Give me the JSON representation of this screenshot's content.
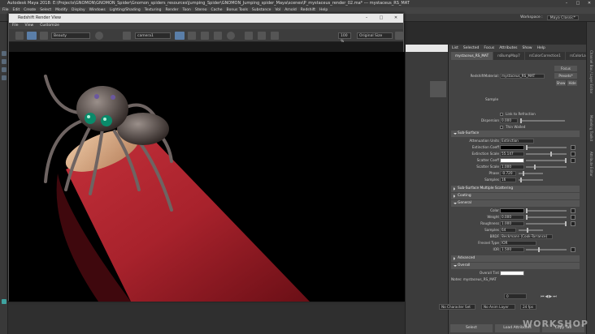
{
  "app": {
    "title": "Autodesk Maya 2018: E:\\Projects\\GNOMON\\GNOMON_Spider\\Gnomon_spiders_resources\\Jumping_Spider\\GNOMON_Jumping_spider_Maya\\scenes\\P_mystaceus_render_02.ma* --- mystaceus_RS_MAT",
    "workspace_label": "Workspace :",
    "workspace_value": "Maya Classic*"
  },
  "menubar": [
    "File",
    "Edit",
    "Create",
    "Select",
    "Modify",
    "Display",
    "Windows",
    "Lighting/Shading",
    "Texturing",
    "Render",
    "Toon",
    "Stereo",
    "Cache",
    "Bonus Tools",
    "Substance",
    "Vol",
    "Arnold",
    "Redshift",
    "Help"
  ],
  "render_view": {
    "title": "Redshift Render View",
    "menu": [
      "File",
      "View",
      "Customize"
    ],
    "aov_combo": "Beauty",
    "camera_combo": "camera1",
    "zoom": "100 %",
    "size_combo": "Original Size"
  },
  "attr_editor": {
    "menu": [
      "List",
      "Selected",
      "Focus",
      "Attributes",
      "Show",
      "Help"
    ],
    "tabs": [
      "mystaceus_RS_MAT",
      "rsBumpMap7",
      "rsColorCorrection1",
      "rsColorLayer"
    ],
    "material_label": "RedshiftMaterial:",
    "material_value": "mystaceus_RS_MAT",
    "focus_btn": "Focus",
    "presets_btn": "Presets*",
    "show_btn": "Show",
    "hide_btn": "Hide",
    "sample_label": "Sample",
    "link_refraction": "Link to Refraction",
    "dispersion_label": "Dispersion",
    "dispersion_value": "0.000",
    "thin_walled": "Thin Walled",
    "sections": {
      "sub_surface": "Sub-Surface",
      "sss_multiple": "Sub-Surface Multiple Scattering",
      "coating": "Coating",
      "general": "General",
      "advanced": "Advanced",
      "overall": "Overall"
    },
    "ss_rows": [
      {
        "label": "Attenuation Units",
        "value": "Extinction"
      },
      {
        "label": "Extinction Coeff",
        "value": ""
      },
      {
        "label": "Extinction Scale",
        "value": "55.147"
      },
      {
        "label": "Scatter Coeff",
        "value": ""
      },
      {
        "label": "Scatter Scale",
        "value": "1.000"
      },
      {
        "label": "Phase",
        "value": "-0.720"
      },
      {
        "label": "Samples",
        "value": "16"
      }
    ],
    "general_rows": [
      {
        "label": "Color",
        "value": ""
      },
      {
        "label": "Weight",
        "value": "0.000"
      },
      {
        "label": "Roughness",
        "value": "1.000"
      },
      {
        "label": "Samples",
        "value": "64"
      },
      {
        "label": "BRDF",
        "value": "Beckmann (Cook-Torrance)"
      },
      {
        "label": "Fresnel Type",
        "value": "IOR"
      },
      {
        "label": "IOR",
        "value": "1.500"
      }
    ],
    "overall_tint_label": "Overall Tint",
    "notes_label": "Notes: mystaceus_RS_MAT",
    "select_btn": "Select",
    "load_attrs_btn": "Load Attributes",
    "copy_tab_btn": "Copy Tab"
  },
  "right_strip": [
    "Attribute Editor",
    "Modeling Toolkit",
    "Channel Box / Layer Editor"
  ],
  "timeline": {
    "frame_value": "0",
    "no_char_set": "No Character Set",
    "no_anim_layer": "No Anim Layer",
    "fps": "24 fps"
  },
  "watermark": "WORKSHOP"
}
